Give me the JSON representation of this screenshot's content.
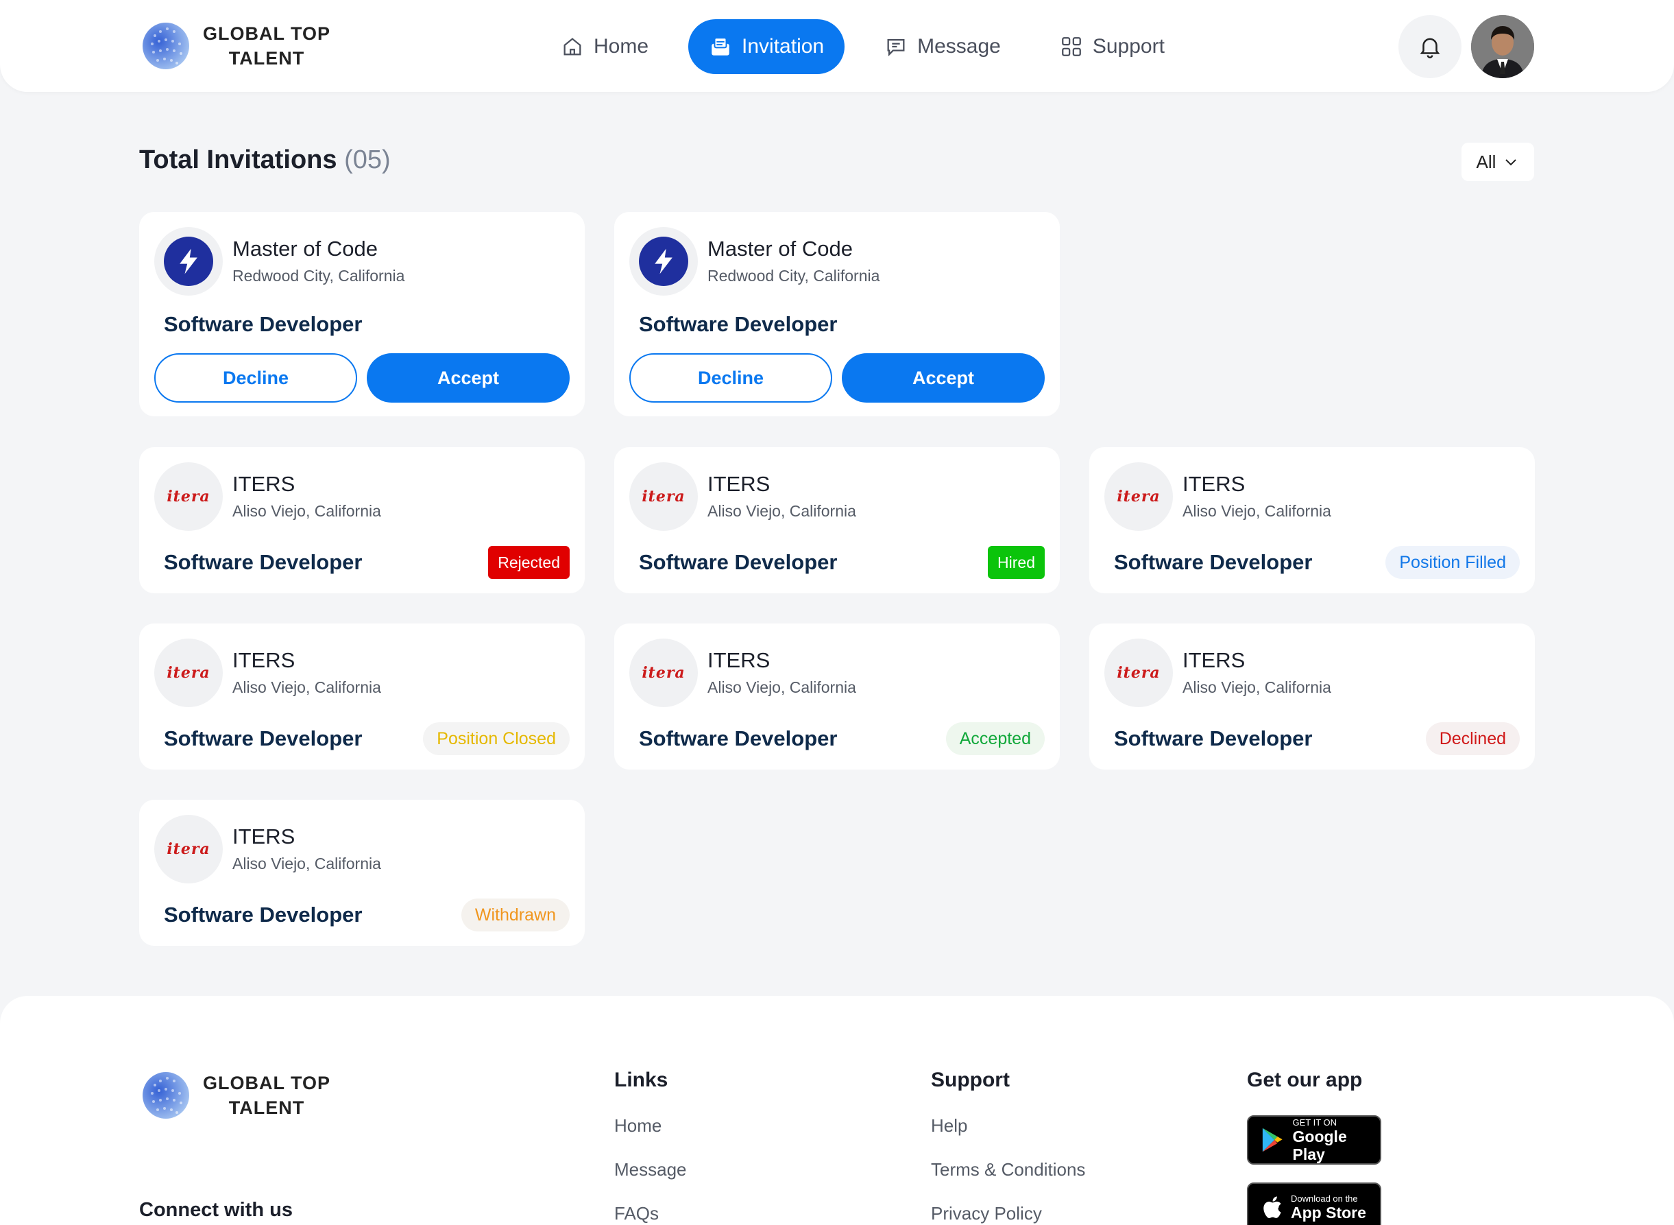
{
  "brand": {
    "line1": "GLOBAL TOP",
    "line2": "TALENT"
  },
  "nav": {
    "items": [
      {
        "label": "Home",
        "icon": "home-icon",
        "active": false
      },
      {
        "label": "Invitation",
        "icon": "invitation-icon",
        "active": true
      },
      {
        "label": "Message",
        "icon": "message-icon",
        "active": false
      },
      {
        "label": "Support",
        "icon": "support-icon",
        "active": false
      }
    ]
  },
  "main": {
    "title": "Total Invitations",
    "count": "(05)",
    "filter": "All"
  },
  "invitations": [
    {
      "company": "Master of Code",
      "location": "Redwood City, California",
      "role": "Software Developer",
      "decline": "Decline",
      "accept": "Accept"
    },
    {
      "company": "Master of Code",
      "location": "Redwood City, California",
      "role": "Software Developer",
      "decline": "Decline",
      "accept": "Accept"
    },
    {
      "company": "ITERS",
      "location": "Aliso Viejo, California",
      "role": "Software Developer",
      "status": "Rejected"
    },
    {
      "company": "ITERS",
      "location": "Aliso Viejo, California",
      "role": "Software Developer",
      "status": "Hired"
    },
    {
      "company": "ITERS",
      "location": "Aliso Viejo, California",
      "role": "Software Developer",
      "status": "Position Filled"
    },
    {
      "company": "ITERS",
      "location": "Aliso Viejo, California",
      "role": "Software Developer",
      "status": "Position Closed"
    },
    {
      "company": "ITERS",
      "location": "Aliso Viejo, California",
      "role": "Software Developer",
      "status": "Accepted"
    },
    {
      "company": "ITERS",
      "location": "Aliso Viejo, California",
      "role": "Software Developer",
      "status": "Declined"
    },
    {
      "company": "ITERS",
      "location": "Aliso Viejo, California",
      "role": "Software Developer",
      "status": "Withdrawn"
    }
  ],
  "logos": {
    "iters_wordmark": "itera"
  },
  "footer": {
    "connect": "Connect with us",
    "links": {
      "title": "Links",
      "items": [
        "Home",
        "Message",
        "FAQs"
      ]
    },
    "support": {
      "title": "Support",
      "items": [
        "Help",
        "Terms & Conditions",
        "Privacy Policy"
      ]
    },
    "app": {
      "title": "Get our app",
      "google": {
        "small": "GET IT ON",
        "big": "Google Play"
      },
      "apple": {
        "small": "Download on the",
        "big": "App Store"
      }
    }
  },
  "colors": {
    "primary": "#0a78f0",
    "rejected": "#e00000",
    "hired": "#0bc40b"
  }
}
